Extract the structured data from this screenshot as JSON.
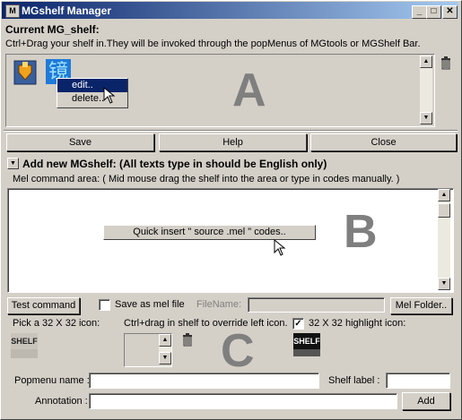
{
  "window": {
    "title": "MGshelf Manager",
    "app_icon_glyph": "M",
    "minimize": "_",
    "maximize": "□",
    "close": "✕"
  },
  "current": {
    "heading": "Current MG_shelf:",
    "instructions": "Ctrl+Drag your shelf in.They will be invoked through the popMenus of MGtools or MGShelf Bar.",
    "letter": "A",
    "shelf_item_2_glyph": "镜",
    "context_menu": {
      "edit": "edit..",
      "delete": "delete.."
    }
  },
  "actions": {
    "save": "Save",
    "help": "Help",
    "close": "Close"
  },
  "add_new": {
    "heading": "Add new MGshelf: (All texts type in should be English only)",
    "mel_area_label": "Mel command area: ( Mid mouse drag the shelf into the area or type in codes manually. )",
    "quick_insert": "Quick insert \" source .mel \" codes..",
    "letter": "B"
  },
  "command_row": {
    "test_command": "Test command",
    "save_as_mel": "Save as mel file",
    "save_as_mel_checked": false,
    "filename_label": "FileName:",
    "filename_value": "",
    "mel_folder": "Mel Folder.."
  },
  "icons": {
    "pick_label": "Pick a 32 X 32 icon:",
    "override_label": "Ctrl+drag in shelf to override left icon.",
    "highlight_label": "32 X 32 highlight icon:",
    "highlight_checked": true,
    "normal_icon_text": "SHELF",
    "highlight_icon_text": "SHELF",
    "letter": "C"
  },
  "form": {
    "popmenu_label": "Popmenu name :",
    "popmenu_value": "",
    "shelf_label_label": "Shelf label :",
    "shelf_label_value": "",
    "annotation_label": "Annotation :",
    "annotation_value": "",
    "add": "Add"
  },
  "colors": {
    "titlebar_start": "#0a246a",
    "titlebar_end": "#a6caf0",
    "letter_gray": "#7f7f7f"
  }
}
